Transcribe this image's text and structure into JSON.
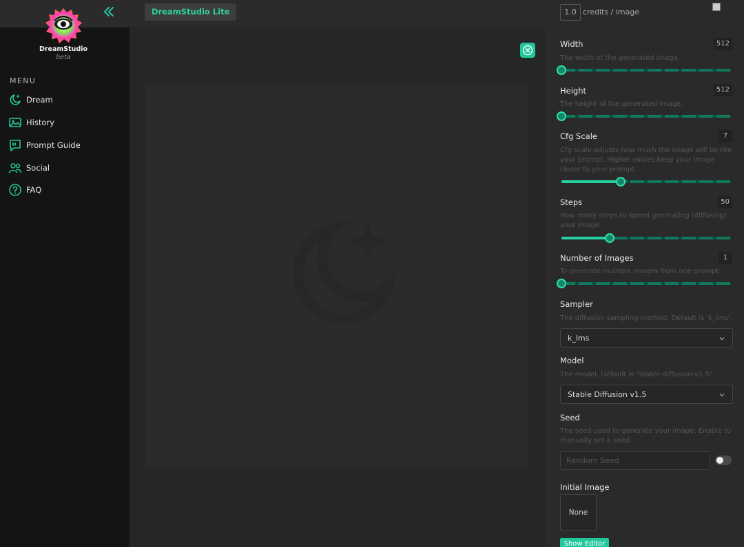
{
  "app": {
    "brand_pill": "DreamStudio Lite",
    "logo_name": "DreamStudio",
    "logo_beta": "beta"
  },
  "sidebar": {
    "menu_title": "MENU",
    "items": [
      {
        "label": "Dream",
        "icon": "moon-star-icon"
      },
      {
        "label": "History",
        "icon": "image-icon"
      },
      {
        "label": "Prompt Guide",
        "icon": "quote-bubble-icon"
      },
      {
        "label": "Social",
        "icon": "people-icon"
      },
      {
        "label": "FAQ",
        "icon": "question-circle-icon"
      }
    ]
  },
  "credits": {
    "value": "1.0",
    "label": "credits / image"
  },
  "params": {
    "width": {
      "title": "Width",
      "desc": "The width of the generated image.",
      "value": "512",
      "fraction": 0.0
    },
    "height": {
      "title": "Height",
      "desc": "The height of the generated image.",
      "value": "512",
      "fraction": 0.0
    },
    "cfg": {
      "title": "Cfg Scale",
      "desc": "Cfg scale adjusts how much the image will be like your prompt. Higher values keep your image closer to your prompt.",
      "value": "7",
      "fraction": 0.35
    },
    "steps": {
      "title": "Steps",
      "desc": "How many steps to spend generating (diffusing) your image.",
      "value": "50",
      "fraction": 0.285
    },
    "images": {
      "title": "Number of Images",
      "desc": "To generate multiple images from one prompt.",
      "value": "1",
      "fraction": 0.0
    }
  },
  "sampler": {
    "title": "Sampler",
    "desc": "The diffusion sampling method. Default is 'k_lms'.",
    "value": "k_lms"
  },
  "model": {
    "title": "Model",
    "desc": "The model. Default is \"stable-diffusion-v1.5\"",
    "value": "Stable Diffusion v1.5"
  },
  "seed": {
    "title": "Seed",
    "desc": "The seed used to generate your image. Enable to manually set a seed.",
    "placeholder": "Random Seed"
  },
  "initial_image": {
    "title": "Initial Image",
    "value": "None",
    "button": "Show Editor"
  },
  "colors": {
    "accent": "#22c79a",
    "sidebar_bg": "#141414",
    "panel_bg": "#2a2a2a"
  }
}
